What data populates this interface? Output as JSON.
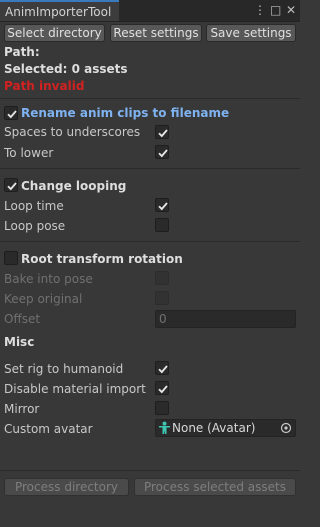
{
  "window": {
    "tab_title": "AnimImporterTool",
    "menu_icon": "more-vertical-icon",
    "maximize_icon": "maximize-icon",
    "close_icon": "close-icon"
  },
  "toolbar": {
    "select_directory": "Select directory",
    "reset_settings": "Reset settings",
    "save_settings": "Save settings"
  },
  "info": {
    "path_label": "Path:",
    "selected_label": "Selected: 0 assets",
    "path_status": "Path invalid"
  },
  "rename": {
    "header": "Rename anim clips to filename",
    "header_checked": true,
    "spaces_label": "Spaces to underscores",
    "spaces_checked": true,
    "lower_label": "To lower",
    "lower_checked": true
  },
  "looping": {
    "header": "Change looping",
    "header_checked": true,
    "loop_time_label": "Loop time",
    "loop_time_checked": true,
    "loop_pose_label": "Loop pose",
    "loop_pose_checked": false
  },
  "root_rotation": {
    "header": "Root transform rotation",
    "header_checked": false,
    "bake_label": "Bake into pose",
    "keep_label": "Keep original",
    "offset_label": "Offset",
    "offset_value": "0"
  },
  "misc": {
    "header": "Misc",
    "rig_label": "Set rig to humanoid",
    "rig_checked": true,
    "material_label": "Disable material import",
    "material_checked": true,
    "mirror_label": "Mirror",
    "mirror_checked": false,
    "avatar_label": "Custom avatar",
    "avatar_value": "None (Avatar)",
    "avatar_icon": "avatar-icon",
    "picker_icon": "object-picker-icon"
  },
  "actions": {
    "process_directory": "Process directory",
    "process_selected": "Process selected assets"
  },
  "colors": {
    "accent": "#3a79bb",
    "error": "#d12121",
    "highlight": "#7fb2f0"
  }
}
